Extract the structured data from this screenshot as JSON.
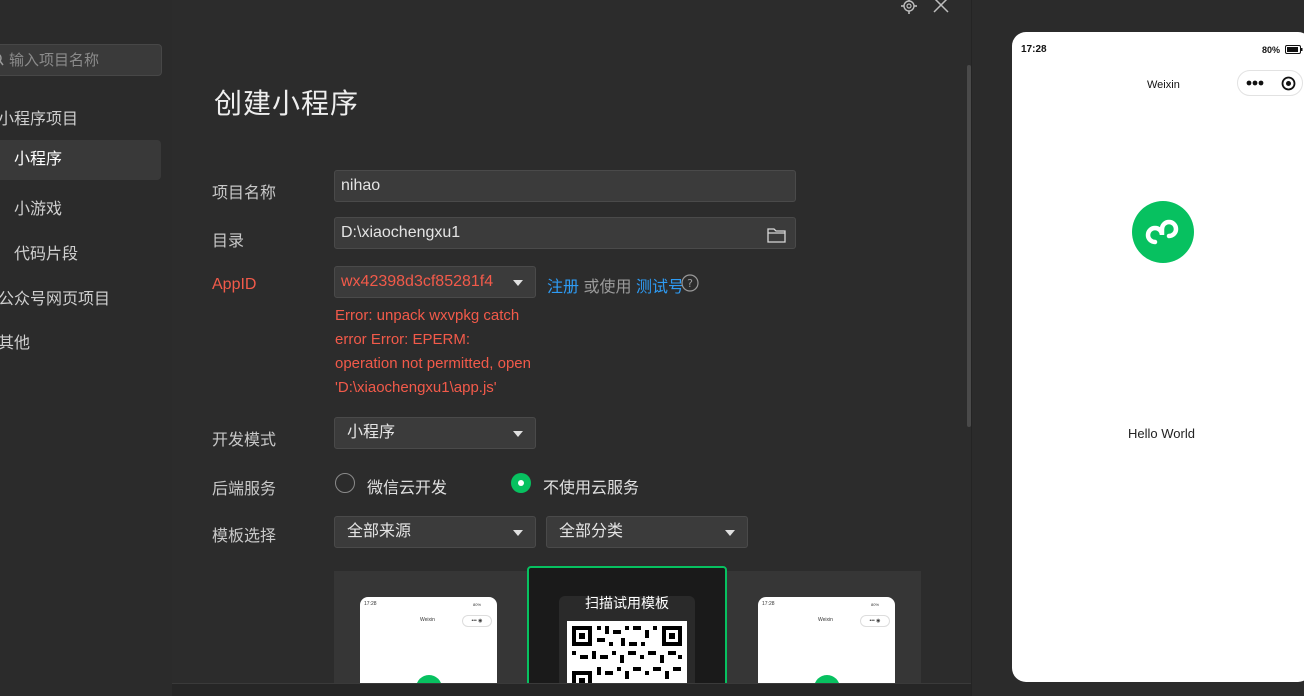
{
  "sidebar": {
    "search_placeholder": "输入项目名称",
    "items": [
      {
        "label": "小程序项目"
      },
      {
        "label": "小程序"
      },
      {
        "label": "小游戏"
      },
      {
        "label": "代码片段"
      },
      {
        "label": "公众号网页项目"
      },
      {
        "label": "其他"
      }
    ]
  },
  "form": {
    "title": "创建小程序",
    "project_name_label": "项目名称",
    "project_name_value": "nihao",
    "directory_label": "目录",
    "directory_value": "D:\\xiaochengxu1",
    "appid_label": "AppID",
    "appid_value": "wx42398d3cf85281f4",
    "register_link": "注册",
    "or_use_text": "或使用",
    "test_id_link": "测试号",
    "error_lines": [
      "Error: unpack wxvpkg catch",
      "error Error: EPERM:",
      "operation not permitted, open",
      "'D:\\xiaochengxu1\\app.js'"
    ],
    "dev_mode_label": "开发模式",
    "dev_mode_value": "小程序",
    "backend_label": "后端服务",
    "backend_options": [
      "微信云开发",
      "不使用云服务"
    ],
    "backend_selected": "不使用云服务",
    "template_label": "模板选择",
    "template_source_value": "全部来源",
    "template_category_value": "全部分类",
    "scan_template_text": "扫描试用模板"
  },
  "preview": {
    "time": "17:28",
    "battery": "80%",
    "nav_title": "Weixin",
    "body_text": "Hello World"
  },
  "mini_phone": {
    "time": "17:28",
    "battery": "80%",
    "nav_title": "Weixin"
  },
  "colors": {
    "accent_green": "#07c160",
    "error_red": "#f25a4a",
    "link_blue": "#2e9cf5"
  }
}
